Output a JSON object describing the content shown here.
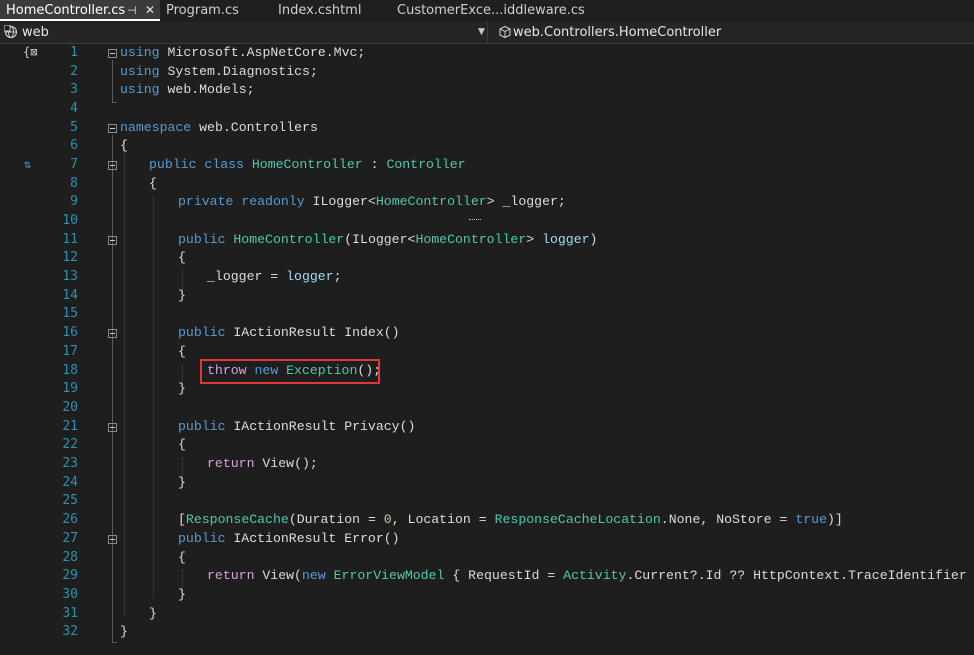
{
  "tabs": [
    {
      "label": "HomeController.cs",
      "active": true,
      "pin_icon": "pin-icon",
      "close_icon": "close-icon",
      "pin_glyph": "⊣",
      "close_glyph": "✕"
    },
    {
      "label": "Program.cs",
      "active": false
    },
    {
      "label": "Index.cshtml",
      "active": false
    },
    {
      "label": "CustomerExce...iddleware.cs",
      "active": false
    }
  ],
  "navbar": {
    "project": {
      "label": "web",
      "icon": "csharp-project-icon"
    },
    "class": {
      "label": "web.Controllers.HomeController",
      "icon": "class-icon"
    },
    "dropdown_glyph": "▼"
  },
  "editor": {
    "line_numbers": [
      "1",
      "2",
      "3",
      "4",
      "5",
      "6",
      "7",
      "8",
      "9",
      "10",
      "11",
      "12",
      "13",
      "14",
      "15",
      "16",
      "17",
      "18",
      "19",
      "20",
      "21",
      "22",
      "23",
      "24",
      "25",
      "26",
      "27",
      "28",
      "29",
      "30",
      "31",
      "32"
    ],
    "margin_icons": {
      "top": "{⊠",
      "line7": "⇅"
    },
    "lines": {
      "l1": {
        "k": "using",
        "t": " Microsoft.AspNetCore.Mvc;"
      },
      "l2": {
        "k": "using",
        "t": " System.Diagnostics;"
      },
      "l3": {
        "k": "using",
        "t": " web.Models;"
      },
      "l5": {
        "k": "namespace",
        "t": " web.Controllers"
      },
      "l6": {
        "t": "{"
      },
      "l7": {
        "k1": "public",
        "k2": " class",
        "ty": " HomeController",
        "t": " : ",
        "ty2": "Controller"
      },
      "l8": {
        "t": "{"
      },
      "l9": {
        "k1": "private",
        "k2": " readonly",
        "t1": " ILogger<",
        "ty": "HomeController",
        "t2": "> _logger;"
      },
      "l11": {
        "k": "public",
        "ty": " HomeController",
        "t1": "(ILogger<",
        "ty2": "HomeController",
        "t2": "> ",
        "id": "logger",
        "t3": ")"
      },
      "l12": {
        "t": "{"
      },
      "l13": {
        "t1": "_logger = ",
        "id": "logger",
        "t2": ";"
      },
      "l14": {
        "t": "}"
      },
      "l16": {
        "k": "public",
        "t": " IActionResult Index()"
      },
      "l17": {
        "t": "{"
      },
      "l18": {
        "c": "throw",
        "k": " new",
        "ty": " Exception",
        "t": "();"
      },
      "l19": {
        "t": "}"
      },
      "l21": {
        "k": "public",
        "t": " IActionResult Privacy()"
      },
      "l22": {
        "t": "{"
      },
      "l23": {
        "c": "return",
        "t1": " View",
        "t2": "();"
      },
      "l24": {
        "t": "}"
      },
      "l26": {
        "t1": "[",
        "ty": "ResponseCache",
        "t2": "(Duration = ",
        "n": "0",
        "t3": ", Location = ",
        "ty2": "ResponseCacheLocation",
        "t4": ".None, NoStore = ",
        "k": "true",
        "t5": ")]"
      },
      "l27": {
        "k": "public",
        "t": " IActionResult Error()"
      },
      "l28": {
        "t": "{"
      },
      "l29": {
        "c": "return",
        "t1": " View(",
        "k": "new",
        "ty": " ErrorViewModel",
        "t2": " { RequestId = ",
        "ty2": "Activity",
        "t3": ".Current?.Id ?? HttpContext.TraceIdentifier });"
      },
      "l30": {
        "t": "}"
      },
      "l31": {
        "t": "}"
      },
      "l32": {
        "t": "}"
      }
    }
  },
  "colors": {
    "keyword": "#569cd6",
    "type": "#4ec9b0",
    "control": "#d8a0df",
    "number": "#b5cea8",
    "line_number": "#2b91af",
    "highlight": "#e0383a"
  }
}
